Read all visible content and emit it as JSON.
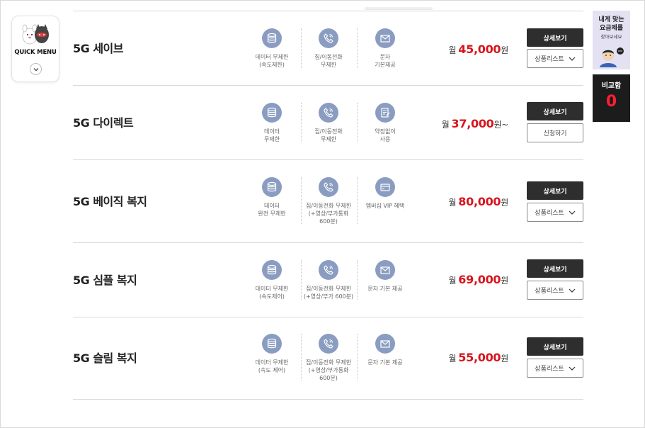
{
  "quick_menu": {
    "label": "QUICK MENU"
  },
  "plans": [
    {
      "name": "5G 세이브",
      "benefits": [
        {
          "icon": "data-icon",
          "text": "데이터 무제한\n(속도제한)"
        },
        {
          "icon": "phone-icon",
          "text": "집/이동전화\n무제한"
        },
        {
          "icon": "message-icon",
          "text": "문자\n기본제공"
        }
      ],
      "price_prefix": "월",
      "price": "45,000",
      "price_unit": "원",
      "detail_label": "상세보기",
      "secondary_label": "상품리스트"
    },
    {
      "name": "5G 다이렉트",
      "benefits": [
        {
          "icon": "data-icon",
          "text": "데이터\n무제한"
        },
        {
          "icon": "phone-icon",
          "text": "집/이동전화\n무제한"
        },
        {
          "icon": "contract-icon",
          "text": "약정없이\n사용"
        }
      ],
      "price_prefix": "월",
      "price": "37,000",
      "price_unit": "원~",
      "detail_label": "상세보기",
      "secondary_label": "신청하기"
    },
    {
      "name": "5G 베이직 복지",
      "benefits": [
        {
          "icon": "data-icon",
          "text": "데이터\n완전 무제한"
        },
        {
          "icon": "phone-icon",
          "text": "집/이동전화 무제한\n(+영상/부가통화\n600분)"
        },
        {
          "icon": "card-icon",
          "text": "멤버십 VIP 혜택"
        }
      ],
      "price_prefix": "월",
      "price": "80,000",
      "price_unit": "원",
      "detail_label": "상세보기",
      "secondary_label": "상품리스트"
    },
    {
      "name": "5G 심플 복지",
      "benefits": [
        {
          "icon": "data-icon",
          "text": "데이터 무제한\n(속도제어)"
        },
        {
          "icon": "phone-icon",
          "text": "집/이동전화 무제한\n(+영상/부가 600분)"
        },
        {
          "icon": "message-icon",
          "text": "문자 기본 제공"
        }
      ],
      "price_prefix": "월",
      "price": "69,000",
      "price_unit": "원",
      "detail_label": "상세보기",
      "secondary_label": "상품리스트"
    },
    {
      "name": "5G 슬림 복지",
      "benefits": [
        {
          "icon": "data-icon",
          "text": "데이터 무제한\n(속도 제어)"
        },
        {
          "icon": "phone-icon",
          "text": "집/이동전화 무제한\n(+영상/부가통화\n600분)"
        },
        {
          "icon": "message-icon",
          "text": "문자 기본 제공"
        }
      ],
      "price_prefix": "월",
      "price": "55,000",
      "price_unit": "원",
      "detail_label": "상세보기",
      "secondary_label": "상품리스트"
    }
  ],
  "side": {
    "find_plan_title": "내게 맞는\n요금제를",
    "find_plan_sub": "찾아보세요",
    "compare_label": "비교함",
    "compare_count": "0"
  },
  "colors": {
    "price": "#d7161e",
    "icon_bg": "#8a9dc1",
    "dark_button": "#2e2e2e",
    "find_plan_bg": "#e4e1f3",
    "compare_bg": "#1c1c1c"
  }
}
